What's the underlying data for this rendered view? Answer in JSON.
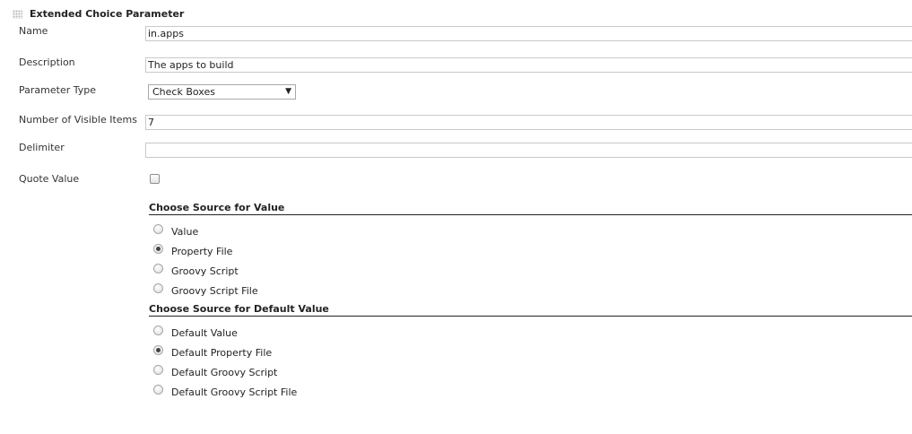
{
  "section": {
    "title": "Extended Choice Parameter"
  },
  "fields": {
    "name": {
      "label": "Name",
      "value": "in.apps"
    },
    "description": {
      "label": "Description",
      "value": "The apps to build"
    },
    "parameter_type": {
      "label": "Parameter Type",
      "selected": "Check Boxes"
    },
    "visible_items": {
      "label": "Number of Visible Items",
      "value": "7"
    },
    "delimiter": {
      "label": "Delimiter",
      "value": ""
    },
    "quote_value": {
      "label": "Quote Value",
      "checked": false
    }
  },
  "value_source": {
    "title": "Choose Source for Value",
    "options": [
      "Value",
      "Property File",
      "Groovy Script",
      "Groovy Script File"
    ],
    "selected": "Property File"
  },
  "default_source": {
    "title": "Choose Source for Default Value",
    "options": [
      "Default Value",
      "Default Property File",
      "Default Groovy Script",
      "Default Groovy Script File"
    ],
    "selected": "Default Property File"
  }
}
